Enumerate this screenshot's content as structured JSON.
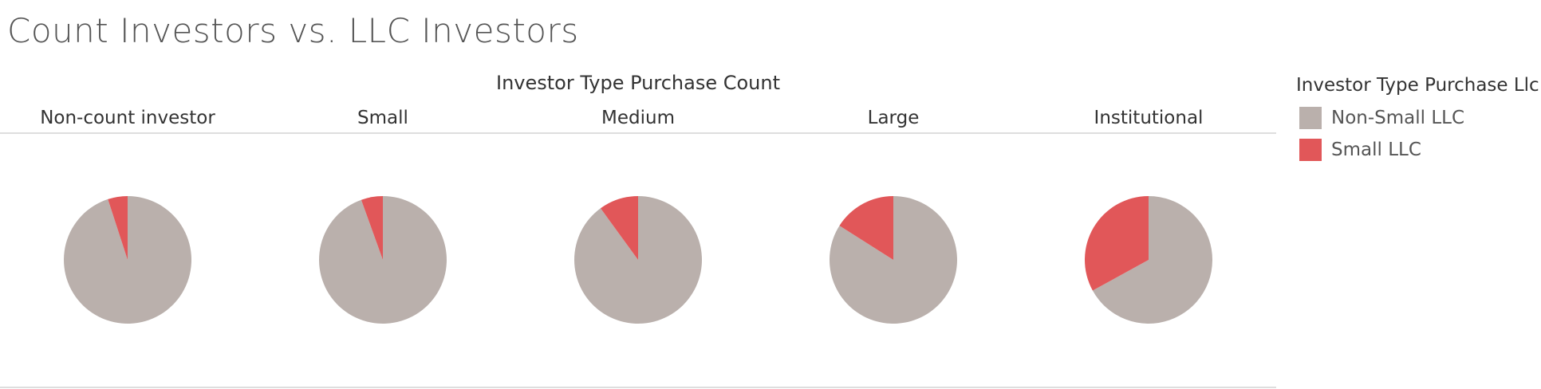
{
  "title": "Count Investors vs. LLC Investors",
  "chart_data": {
    "type": "pie",
    "title": "Count Investors vs. LLC Investors",
    "column_header": "Investor Type Purchase Count",
    "categories": [
      "Non-count investor",
      "Small",
      "Medium",
      "Large",
      "Institutional"
    ],
    "series": [
      {
        "name": "Non-Small LLC",
        "values": [
          0.95,
          0.945,
          0.9,
          0.84,
          0.67
        ]
      },
      {
        "name": "Small LLC",
        "values": [
          0.05,
          0.055,
          0.1,
          0.16,
          0.33
        ]
      }
    ],
    "legend": {
      "title": "Investor Type Purchase Llc",
      "placement": "right"
    }
  },
  "colors": {
    "Non-Small LLC": "#BAB0AC",
    "Small LLC": "#E15759",
    "divider": "#D4D4D4"
  }
}
